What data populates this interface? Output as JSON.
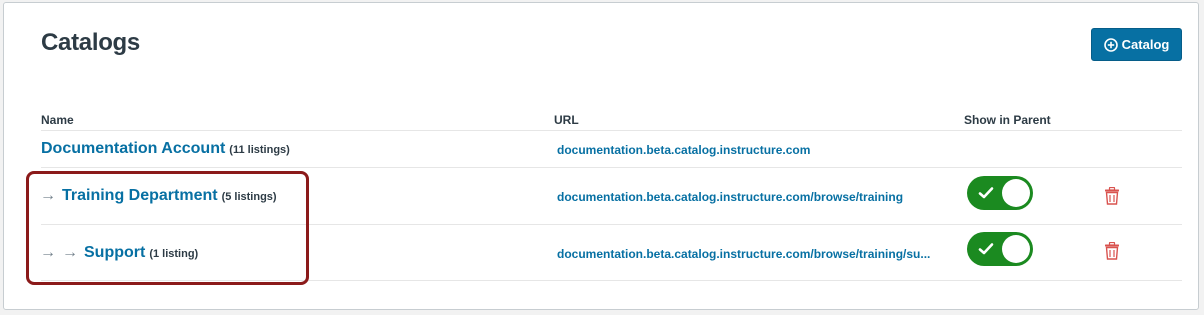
{
  "page": {
    "title": "Catalogs"
  },
  "toolbar": {
    "add_catalog_label": "Catalog"
  },
  "table": {
    "headers": {
      "name": "Name",
      "url": "URL",
      "show_in_parent": "Show in Parent"
    },
    "rows": [
      {
        "name": "Documentation Account",
        "count": "(11 listings)",
        "url": "documentation.beta.catalog.instructure.com",
        "depth": 0,
        "show_in_parent": null
      },
      {
        "name": "Training Department",
        "count": "(5 listings)",
        "url": "documentation.beta.catalog.instructure.com/browse/training",
        "depth": 1,
        "show_in_parent": true
      },
      {
        "name": "Support",
        "count": "(1 listing)",
        "url": "documentation.beta.catalog.instructure.com/browse/training/su...",
        "depth": 2,
        "show_in_parent": true
      }
    ]
  },
  "colors": {
    "primary": "#0770a3",
    "toggle_on": "#1b8a20",
    "delete": "#ee0612",
    "highlight_box": "#8b1a1a"
  },
  "icons": {
    "add": "plus-circle-icon",
    "nested": "arrow-right-icon",
    "toggle_on": "check-icon",
    "delete": "trash-icon"
  }
}
